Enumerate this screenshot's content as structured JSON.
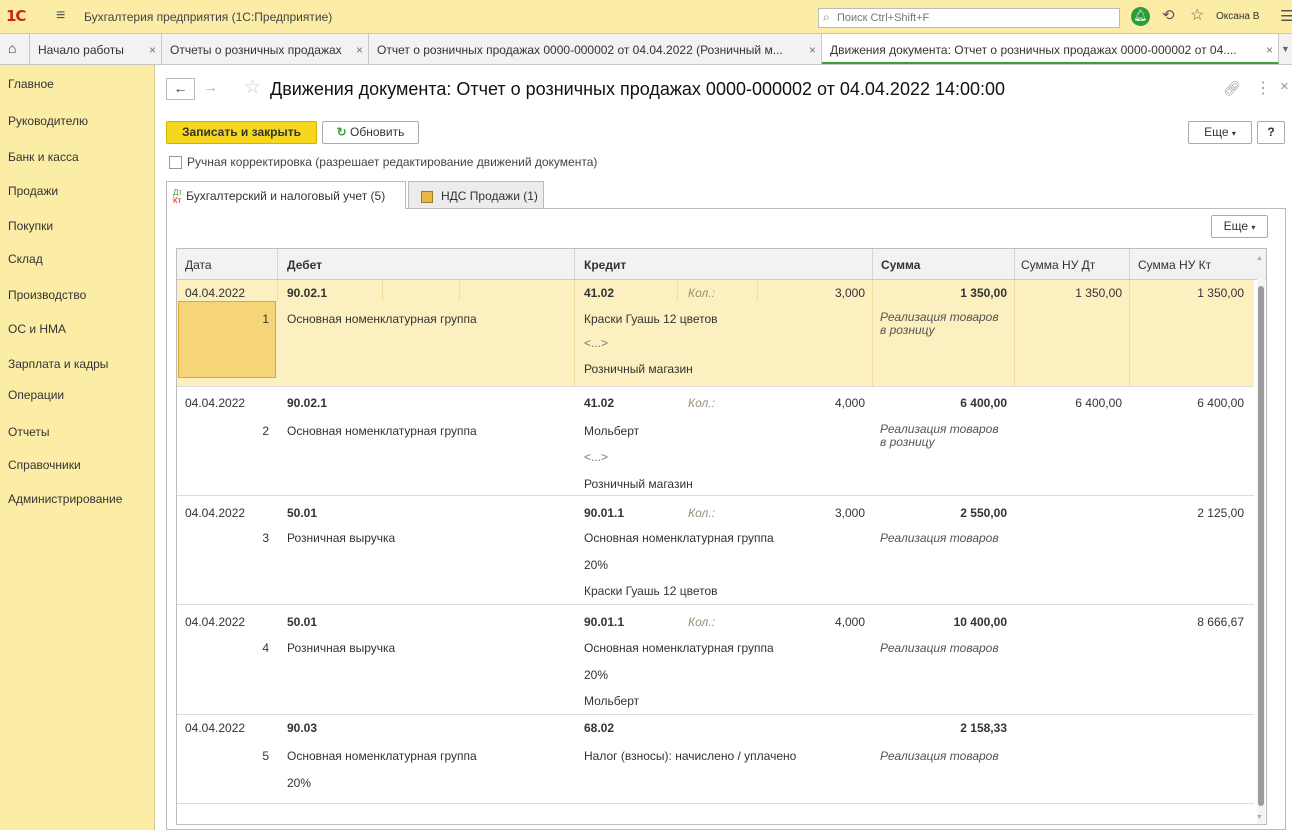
{
  "app": {
    "logo": "1С",
    "title": "Бухгалтерия предприятия (1С:Предприятие)",
    "search_placeholder": "Поиск Ctrl+Shift+F",
    "user": "Оксана В"
  },
  "tabs": [
    {
      "label": "Начало работы"
    },
    {
      "label": "Отчеты о розничных продажах"
    },
    {
      "label": "Отчет о розничных продажах 0000-000002 от 04.04.2022 (Розничный м..."
    },
    {
      "label": "Движения документа: Отчет о розничных продажах 0000-000002 от 04...."
    }
  ],
  "sidebar": {
    "items": [
      {
        "label": "Главное"
      },
      {
        "label": "Руководителю"
      },
      {
        "label": "Банк и касса"
      },
      {
        "label": "Продажи"
      },
      {
        "label": "Покупки"
      },
      {
        "label": "Склад"
      },
      {
        "label": "Производство"
      },
      {
        "label": "ОС и НМА"
      },
      {
        "label": "Зарплата и кадры"
      },
      {
        "label": "Операции"
      },
      {
        "label": "Отчеты"
      },
      {
        "label": "Справочники"
      },
      {
        "label": "Администрирование"
      }
    ]
  },
  "form": {
    "title": "Движения документа: Отчет о розничных продажах 0000-000002 от 04.04.2022 14:00:00",
    "save_close": "Записать и закрыть",
    "refresh": "Обновить",
    "more": "Еще",
    "help": "?",
    "manual_label": "Ручная корректировка (разрешает редактирование движений документа)",
    "manual_checked": false
  },
  "doc_tabs": {
    "accounting": "Бухгалтерский и налоговый учет (5)",
    "accounting_icon_top": "Дт",
    "accounting_icon_bottom": "Кт",
    "vat": "НДС Продажи (1)"
  },
  "grid": {
    "more": "Еще",
    "columns": {
      "date": "Дата",
      "debit": "Дебет",
      "credit": "Кредит",
      "sum": "Сумма",
      "nu_dt": "Сумма НУ Дт",
      "nu_kt": "Сумма НУ Кт"
    },
    "qty_label": "Кол.:",
    "rows": [
      {
        "date": "04.04.2022",
        "num": "1",
        "debit_account": "90.02.1",
        "debit_sub": [
          "Основная номенклатурная группа"
        ],
        "credit_account": "41.02",
        "qty": "3,000",
        "credit_sub": [
          "Краски Гуашь 12 цветов",
          "<...>",
          "Розничный магазин"
        ],
        "sum": "1 350,00",
        "content": "Реализация товаров в розницу",
        "nu_dt": "1 350,00",
        "nu_kt": "1 350,00"
      },
      {
        "date": "04.04.2022",
        "num": "2",
        "debit_account": "90.02.1",
        "debit_sub": [
          "Основная номенклатурная группа"
        ],
        "credit_account": "41.02",
        "qty": "4,000",
        "credit_sub": [
          "Мольберт",
          "<...>",
          "Розничный магазин"
        ],
        "sum": "6 400,00",
        "content": "Реализация товаров в розницу",
        "nu_dt": "6 400,00",
        "nu_kt": "6 400,00"
      },
      {
        "date": "04.04.2022",
        "num": "3",
        "debit_account": "50.01",
        "debit_sub": [
          "Розничная выручка"
        ],
        "credit_account": "90.01.1",
        "qty": "3,000",
        "credit_sub": [
          "Основная номенклатурная группа",
          "20%",
          "Краски Гуашь 12 цветов"
        ],
        "sum": "2 550,00",
        "content": "Реализация товаров",
        "nu_dt": "",
        "nu_kt": "2 125,00"
      },
      {
        "date": "04.04.2022",
        "num": "4",
        "debit_account": "50.01",
        "debit_sub": [
          "Розничная выручка"
        ],
        "credit_account": "90.01.1",
        "qty": "4,000",
        "credit_sub": [
          "Основная номенклатурная группа",
          "20%",
          "Мольберт"
        ],
        "sum": "10 400,00",
        "content": "Реализация товаров",
        "nu_dt": "",
        "nu_kt": "8 666,67"
      },
      {
        "date": "04.04.2022",
        "num": "5",
        "debit_account": "90.03",
        "debit_sub": [
          "Основная номенклатурная группа",
          "20%"
        ],
        "credit_account": "68.02",
        "qty": "",
        "credit_sub": [
          "Налог (взносы): начислено / уплачено"
        ],
        "sum": "2 158,33",
        "content": "Реализация товаров",
        "nu_dt": "",
        "nu_kt": ""
      }
    ]
  }
}
